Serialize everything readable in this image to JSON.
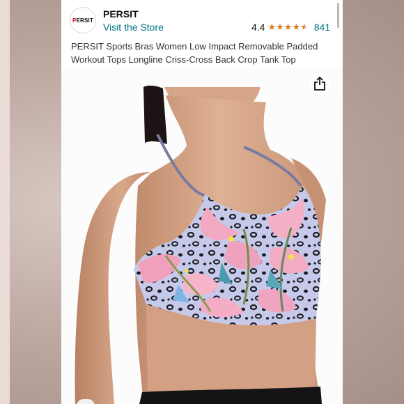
{
  "header": {
    "logo_text_p": "P",
    "logo_text_rest": "ERSIT",
    "brand": "PERSIT",
    "store_link": "Visit the Store",
    "rating_value": "4.4",
    "rating_count": "841",
    "rating_stars": 4.4,
    "rating_max": 5
  },
  "product": {
    "title": "PERSIT Sports Bras Women Low Impact Removable Padded Workout Tops Longline Criss-Cross Back Crop Tank Top"
  },
  "icons": {
    "share": "share-icon",
    "star": "star-icon"
  },
  "colors": {
    "link": "#007185",
    "star": "#de7921",
    "text": "#0f1111",
    "skin": "#d7a88a",
    "top_pink": "#f1a7c0",
    "top_lavender": "#b9b4e8"
  }
}
